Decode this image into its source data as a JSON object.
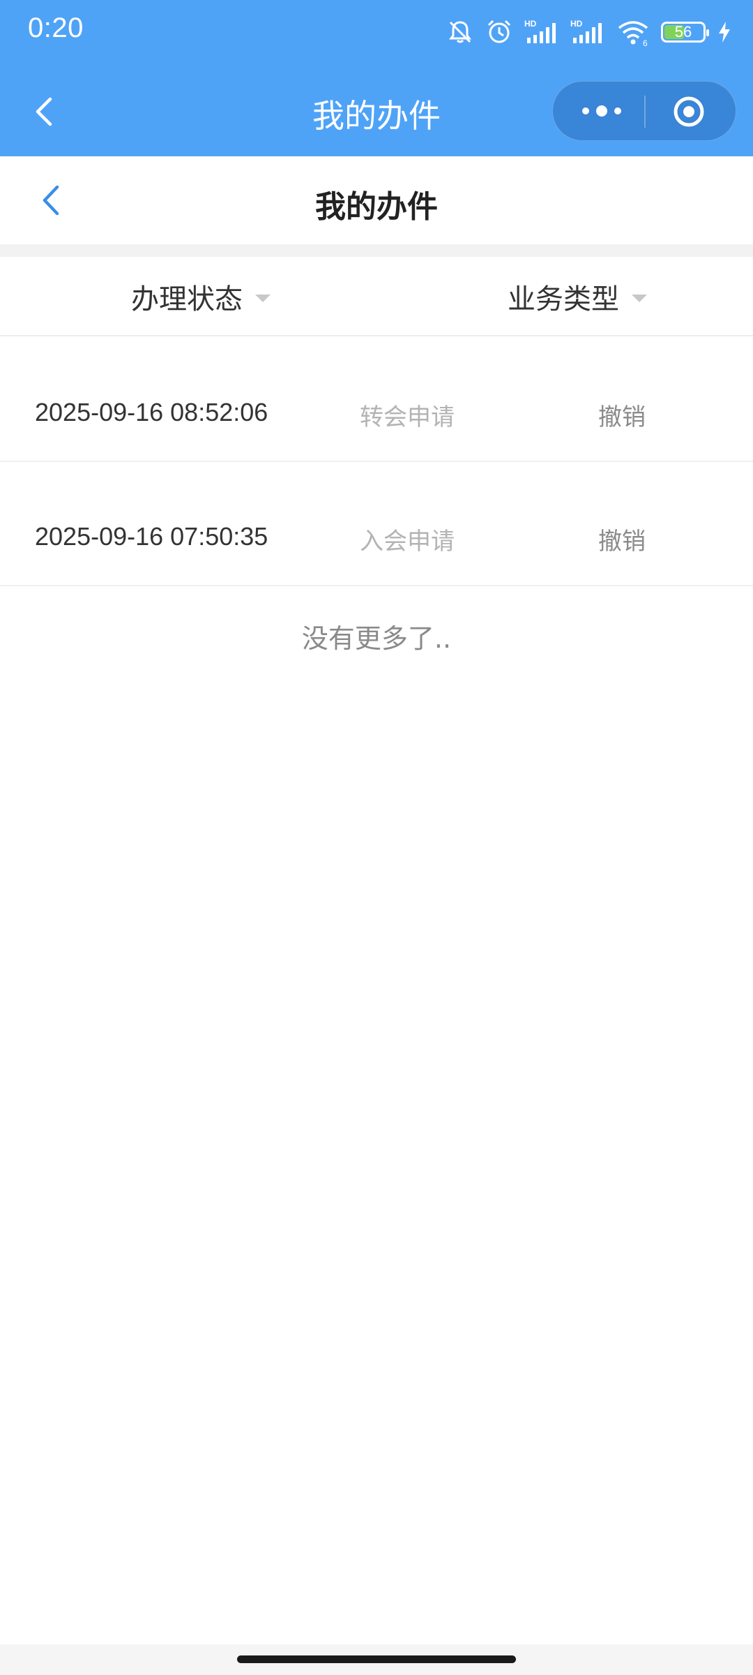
{
  "status_bar": {
    "time": "0:20",
    "battery_level": 56,
    "battery_text": "56",
    "icons": [
      "bell-muted-icon",
      "alarm-icon",
      "signal-hd-icon",
      "signal-hd-icon",
      "wifi-icon",
      "battery-icon",
      "charging-icon"
    ]
  },
  "wx_header": {
    "title": "我的办件"
  },
  "page_nav": {
    "title": "我的办件"
  },
  "filters": {
    "status_label": "办理状态",
    "type_label": "业务类型"
  },
  "records": [
    {
      "time": "2025-09-16 08:52:06",
      "type": "转会申请",
      "status": "撤销"
    },
    {
      "time": "2025-09-16 07:50:35",
      "type": "入会申请",
      "status": "撤销"
    }
  ],
  "footer": {
    "no_more": "没有更多了.."
  },
  "colors": {
    "header_blue": "#4fa3f7",
    "back_blue": "#3a8ee6",
    "battery_green": "#7fd35a"
  }
}
